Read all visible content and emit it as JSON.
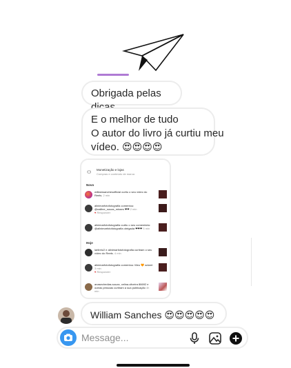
{
  "messages": [
    {
      "text": "Obrigada pelas dicas"
    },
    {
      "lines": [
        "E o melhor de tudo",
        "O autor do livro já curtiu meu",
        "vídeo."
      ],
      "emojis": "😍😍😍😍"
    }
  ],
  "screenshot": {
    "header_title": "Monetização e lojas",
    "header_subtitle": "Compras e conteúdo de marca",
    "section_new": "Novo",
    "section_today": "Hoje",
    "rows": [
      {
        "text": "williamsanchesofficial curtiu o seu vídeo do Reels.",
        "time": "2 min"
      },
      {
        "text": "alinimarfotofotografia comentou: @nalline_souza_miraes ❤❤",
        "time": "2 min",
        "reply": "Responder"
      },
      {
        "text": "alinimarfotofotografia curtiu o seu comentário: @alinimarfotofotografia obrigada ❤❤❤",
        "time": "5 min"
      },
      {
        "text": "larilretz2 e alinimarfotofotografia curtiram o seu vídeo do Reels.",
        "time": "4 min"
      },
      {
        "text": "alinimarfotofotografia comentou: Meu 🧡 adorei",
        "time": "3 min",
        "reply": "Responder"
      },
      {
        "text": "anasechedias.souza, celina.oliveira 86692 e outras pessoas curtiram a sua publicação",
        "time": "4h min"
      }
    ]
  },
  "final_message": {
    "text": "William Sanches",
    "emojis": "😍😍😍😍😍"
  },
  "composer": {
    "placeholder": "Message..."
  },
  "icons": [
    "paper-plane-icon",
    "camera-icon",
    "microphone-icon",
    "gallery-icon",
    "plus-circle-icon"
  ],
  "colors": {
    "accent": "#3897f0",
    "bubble_border": "#ececec",
    "placeholder": "#8e8e8e"
  }
}
